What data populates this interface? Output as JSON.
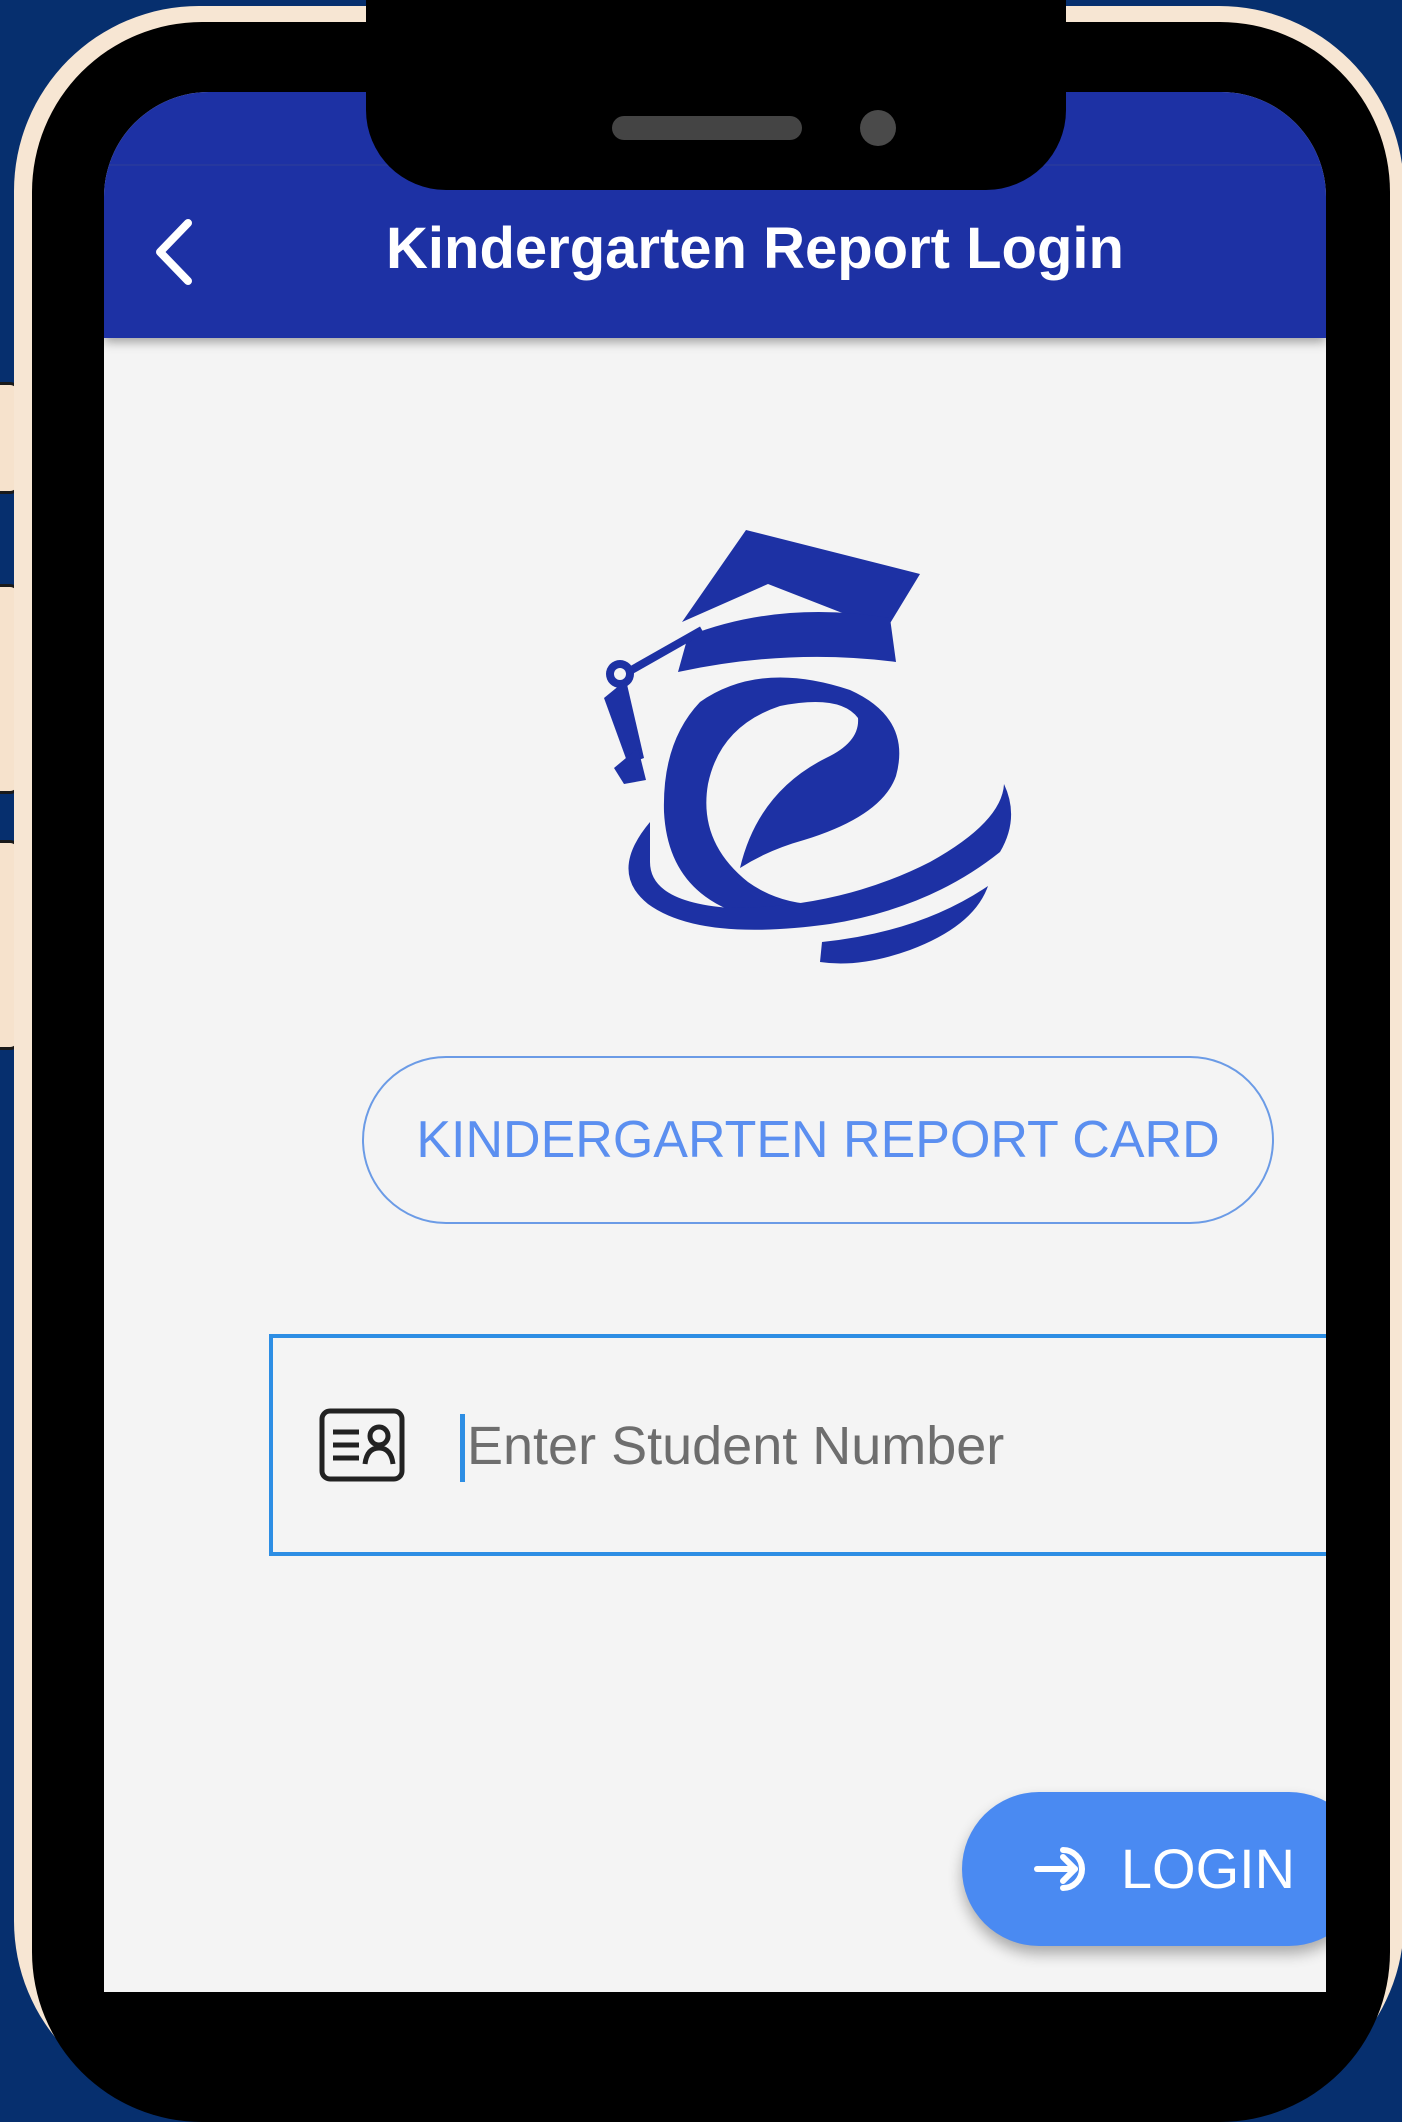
{
  "header": {
    "title": "Kindergarten Report Login",
    "back_icon": "chevron-left-icon"
  },
  "logo": {
    "icon": "graduation-cap-e-logo"
  },
  "app_name_badge": {
    "label": "KINDERGARTEN REPORT CARD"
  },
  "student_number": {
    "placeholder": "Enter Student Number",
    "value": "",
    "icon": "id-card-icon"
  },
  "login_button": {
    "label": "LOGIN",
    "icon": "login-arrow-icon"
  },
  "colors": {
    "background": "#062f6e",
    "app_bar": "#1d31a4",
    "accent_blue": "#4a8af2",
    "input_border": "#2d8ee4",
    "badge_text": "#5b8ff0",
    "phone_frame": "#f7e6d3"
  }
}
